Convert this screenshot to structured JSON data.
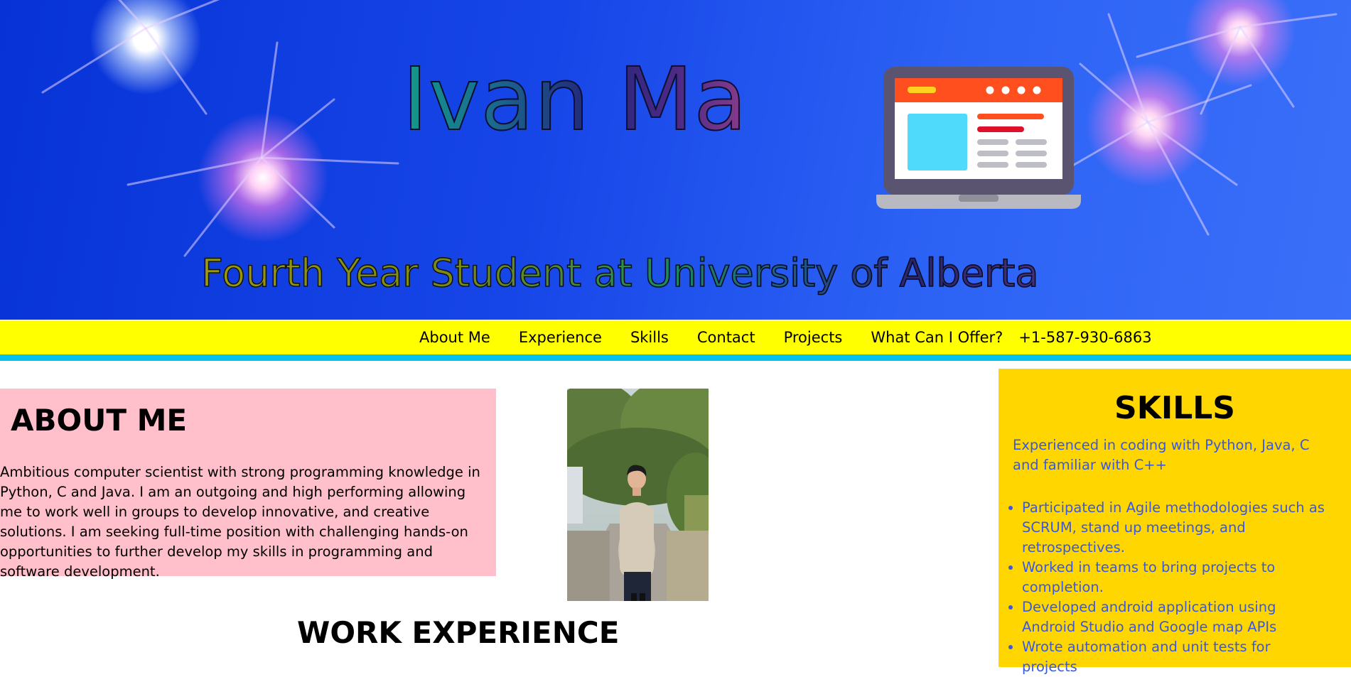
{
  "hero": {
    "name": "Ivan Ma",
    "subtitle": "Fourth Year Student at University of Alberta"
  },
  "nav": {
    "items": [
      "About Me",
      "Experience",
      "Skills",
      "Contact",
      "Projects",
      "What Can I Offer?"
    ],
    "phone": "+1-587-930-6863"
  },
  "about": {
    "heading": "ABOUT ME",
    "text": "Ambitious computer scientist with strong programming knowledge in Python, C and Java. I am an outgoing and high performing allowing me to work well in groups to develop innovative, and creative solutions. I am seeking full-time position with challenging hands-on opportunities to further develop my skills in programming and software development."
  },
  "work": {
    "heading": "WORK EXPERIENCE"
  },
  "skills": {
    "heading": "SKILLS",
    "intro": "Experienced in coding with Python, Java, C and familiar with C++",
    "items": [
      "Participated in Agile methodologies such as SCRUM, stand up meetings, and retrospectives.",
      "Worked in teams to bring projects to completion.",
      "Developed android application using Android Studio and Google map APIs",
      "Wrote automation and unit tests for projects"
    ]
  },
  "colors": {
    "hero_blue": "#1746e8",
    "nav_yellow": "#ffff00",
    "stripe_cyan": "#00c2ef",
    "about_pink": "#ffc0cb",
    "skills_gold": "#ffd600",
    "skills_text": "#3a58e0"
  },
  "icons": [
    "laptop-illustration",
    "sparkle-decoration",
    "profile-photo"
  ]
}
